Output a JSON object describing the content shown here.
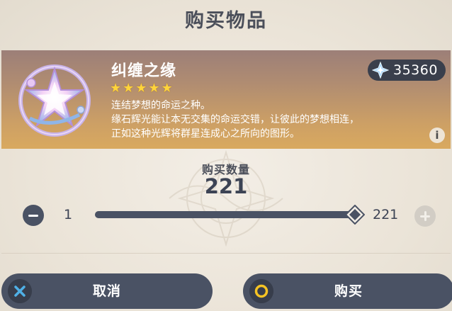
{
  "dialog": {
    "title": "购买物品"
  },
  "item": {
    "name": "纠缠之缘",
    "rarity_stars": 5,
    "star_glyph": "★",
    "description_lines": [
      "连结梦想的命运之种。",
      "缘石辉光能让本无交集的命运交错，让彼此的梦想相连，",
      "正如这种光辉将群星连成心之所向的图形。"
    ],
    "info_glyph": "i",
    "icon": "intertwined-fate-icon"
  },
  "currency": {
    "icon": "primogem-icon",
    "amount": "35360"
  },
  "quantity": {
    "label": "购买数量",
    "value": "221",
    "min_label": "1",
    "max_label": "221",
    "slider_fraction": 1.0
  },
  "buttons": {
    "cancel_label": "取消",
    "buy_label": "购买"
  },
  "colors": {
    "dark": "#4a5264",
    "star": "#ffd43b",
    "accent_x": "#4fb0e6",
    "accent_o": "#f5c324"
  }
}
